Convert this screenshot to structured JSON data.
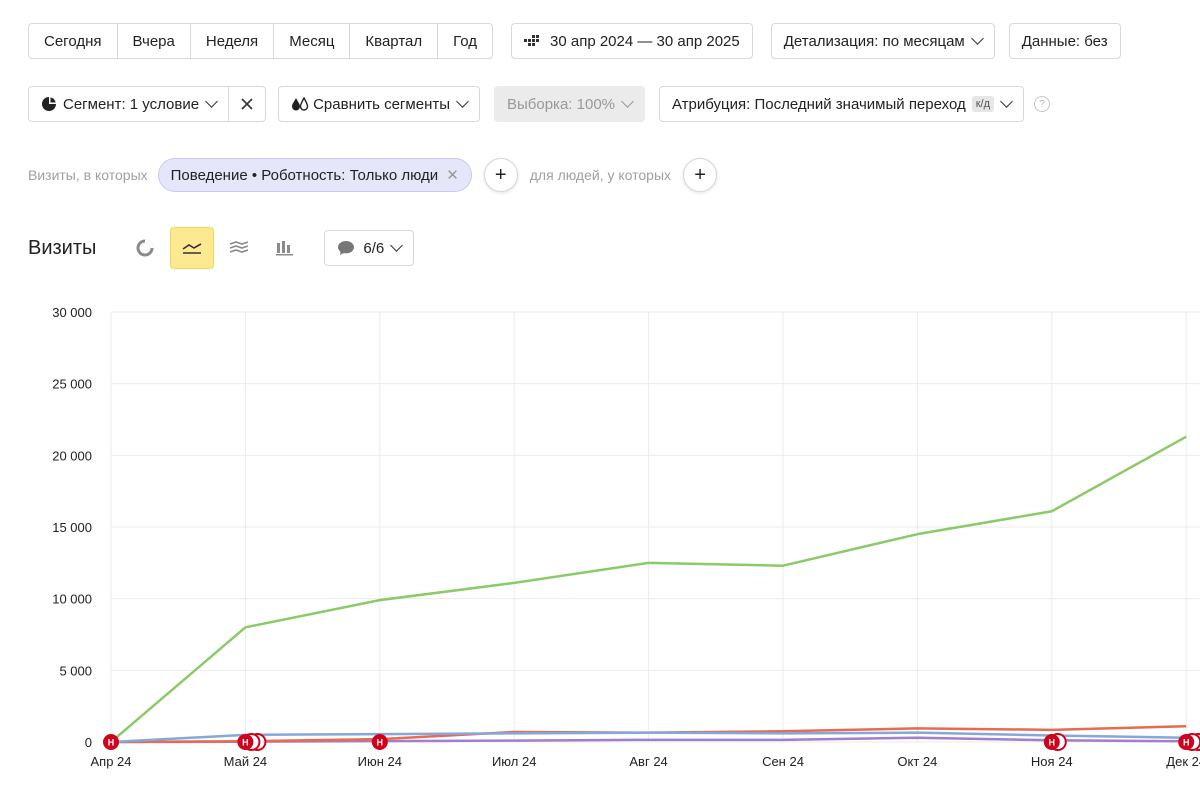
{
  "period_buttons": [
    "Сегодня",
    "Вчера",
    "Неделя",
    "Месяц",
    "Квартал",
    "Год"
  ],
  "date_range": "30 апр 2024 — 30 апр 2025",
  "detail": "Детализация: по месяцам",
  "data_label": "Данные: без",
  "segment": "Сегмент: 1 условие",
  "compare": "Сравнить сегменты",
  "sample": "Выборка: 100%",
  "attribution": "Атрибуция: Последний значимый переход",
  "attribution_badge": "к/д",
  "help": "?",
  "filter": {
    "visits_prefix": "Визиты, в которых",
    "chip": "Поведение • Роботность: Только люди",
    "people_prefix": "для людей, у которых"
  },
  "chart_header": {
    "title": "Визиты",
    "notes_count": "6/6"
  },
  "colors": {
    "green": "#8cc967",
    "blue": "#85a7da",
    "red": "#e86a50",
    "purple": "#a17fcc",
    "marker": "#d0021b",
    "accent_yellow": "#fde98f"
  },
  "icons": [
    "pie-icon",
    "line-chart-icon",
    "area-chart-icon",
    "bar-chart-icon",
    "comment-icon",
    "calendar-icon",
    "segment-pie-icon",
    "compare-drops-icon",
    "close-icon",
    "plus-icon"
  ],
  "chart_data": {
    "type": "line",
    "categories": [
      "Апр 24",
      "Май 24",
      "Июн 24",
      "Июл 24",
      "Авг 24",
      "Сен 24",
      "Окт 24",
      "Ноя 24",
      "Дек 24"
    ],
    "ylim": [
      0,
      30000
    ],
    "yticks": [
      0,
      5000,
      10000,
      15000,
      20000,
      25000,
      30000
    ],
    "ytick_labels": [
      "0",
      "5 000",
      "10 000",
      "15 000",
      "20 000",
      "25 000",
      "30 000"
    ],
    "grid": true,
    "series": [
      {
        "color": "#8cc967",
        "values": [
          0,
          8000,
          9900,
          11100,
          12500,
          12300,
          14500,
          16100,
          21300
        ]
      },
      {
        "color": "#85a7da",
        "values": [
          0,
          500,
          550,
          600,
          650,
          600,
          650,
          450,
          300
        ]
      },
      {
        "color": "#e86a50",
        "values": [
          0,
          50,
          200,
          700,
          650,
          750,
          950,
          850,
          1100
        ]
      },
      {
        "color": "#a17fcc",
        "values": [
          0,
          20,
          60,
          100,
          150,
          150,
          300,
          120,
          50
        ]
      }
    ],
    "markers": [
      {
        "x": "Апр 24",
        "label": "Н",
        "count": 1
      },
      {
        "x": "Май 24",
        "label": "Н",
        "count": 3
      },
      {
        "x": "Июн 24",
        "label": "Н",
        "count": 1
      },
      {
        "x": "Ноя 24",
        "label": "Н",
        "count": 2
      },
      {
        "x": "Дек 24",
        "label": "Н",
        "count": 3
      }
    ]
  }
}
